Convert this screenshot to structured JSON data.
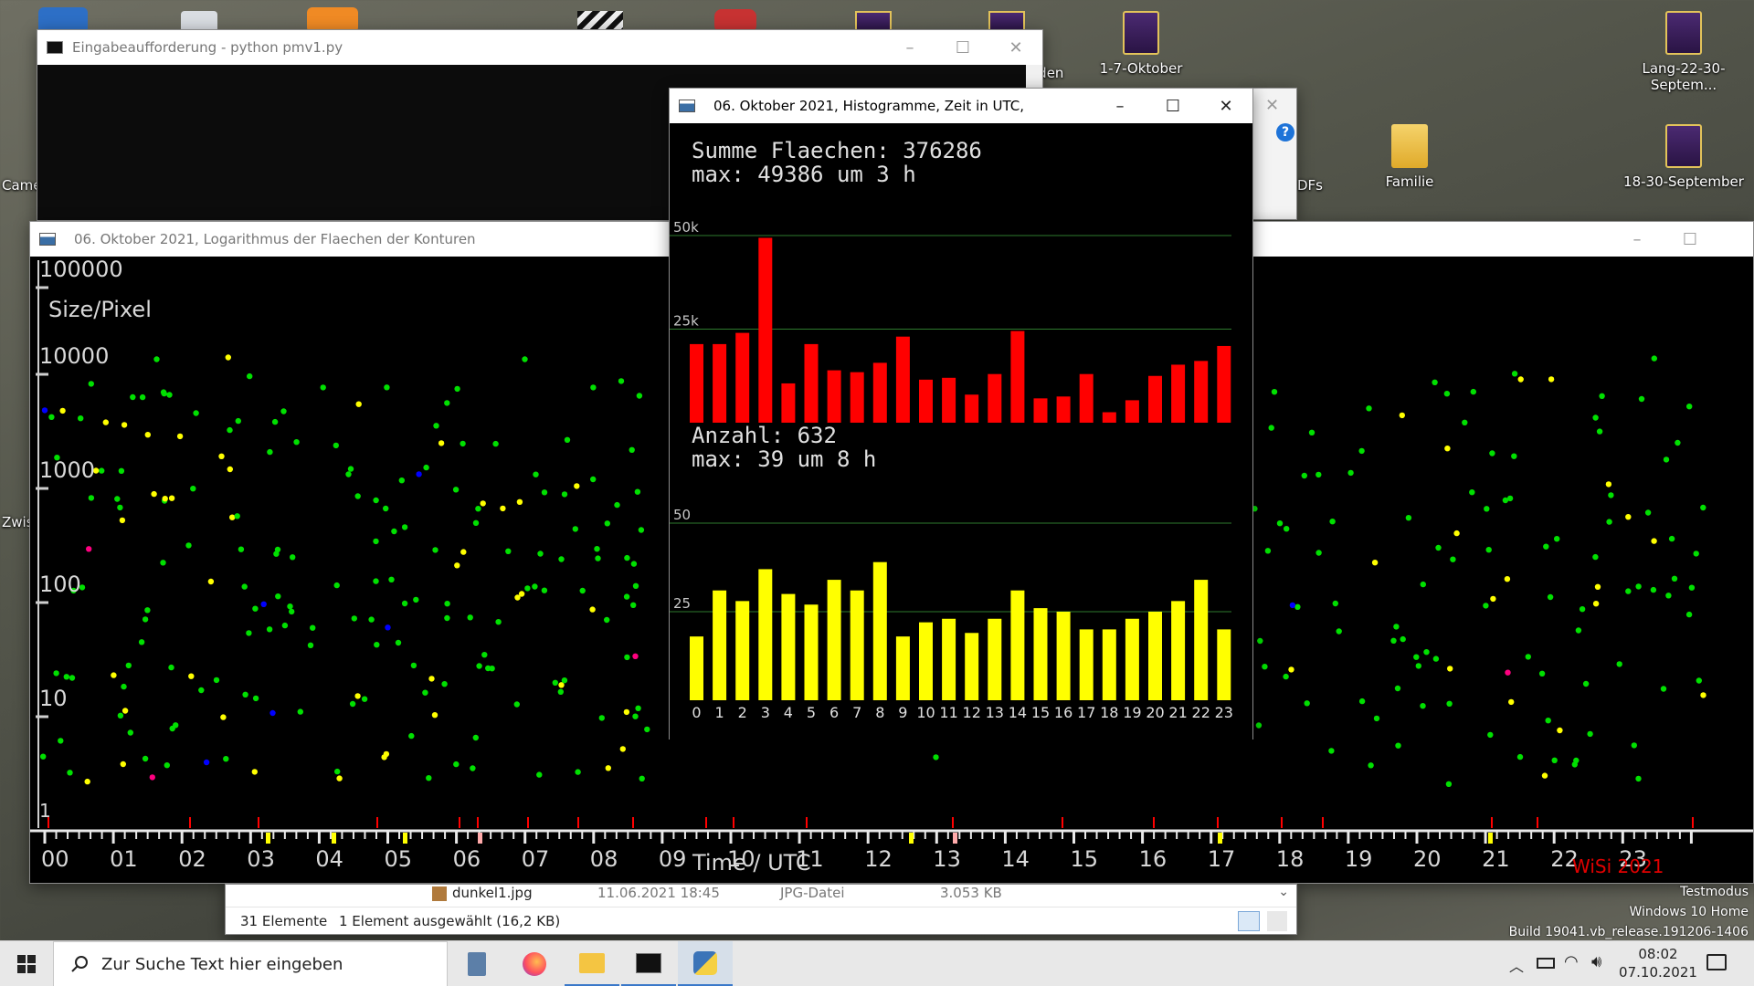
{
  "desktop": {
    "icons": [
      {
        "label": "1-7-Oktober",
        "kind": "folder-dark"
      },
      {
        "label": "Lang-22-30-Septem...",
        "kind": "folder-dark"
      },
      {
        "label": "Familie",
        "kind": "folder"
      },
      {
        "label": "18-30-September",
        "kind": "folder-dark"
      },
      {
        "label": "iden",
        "kind": "partial"
      },
      {
        "label": "DFs",
        "kind": "partial"
      },
      {
        "label": "Came",
        "kind": "partial"
      },
      {
        "label": "Zwis",
        "kind": "partial"
      }
    ]
  },
  "cmd_window": {
    "title": "Eingabeaufforderung - python  pmv1.py"
  },
  "scatter_window": {
    "title": "06. Oktober 2021, Logarithmus der Flaechen der Konturen",
    "ylabel": "Size/Pixel",
    "yticks": [
      "100000",
      "10000",
      "1000",
      "100",
      "10",
      "1"
    ],
    "hours": [
      "00",
      "01",
      "02",
      "03",
      "04",
      "05",
      "06",
      "07",
      "08",
      "09",
      "10",
      "11",
      "12",
      "13",
      "14",
      "15",
      "16",
      "17",
      "18",
      "19",
      "20",
      "21",
      "22",
      "23"
    ],
    "xlabel": "Time  /  UTC",
    "signature": "WiSi 2021"
  },
  "hist_window": {
    "title": "06. Oktober 2021, Histogramme, Zeit in UTC,",
    "area_line1": "Summe Flaechen: 376286",
    "area_line2": "max: 49386 um 3 h",
    "count_line1": "Anzahl: 632",
    "count_line2": "max: 39 um 8 h",
    "area_ticks": [
      "50k",
      "25k"
    ],
    "count_ticks": [
      "50",
      "25"
    ],
    "hours": [
      "0",
      "1",
      "2",
      "3",
      "4",
      "5",
      "6",
      "7",
      "8",
      "9",
      "10",
      "11",
      "12",
      "13",
      "14",
      "15",
      "16",
      "17",
      "18",
      "19",
      "20",
      "21",
      "22",
      "23"
    ]
  },
  "chart_data": [
    {
      "type": "bar",
      "title": "Summe Flaechen: 376286",
      "categories": [
        "0",
        "1",
        "2",
        "3",
        "4",
        "5",
        "6",
        "7",
        "8",
        "9",
        "10",
        "11",
        "12",
        "13",
        "14",
        "15",
        "16",
        "17",
        "18",
        "19",
        "20",
        "21",
        "22",
        "23"
      ],
      "values": [
        21000,
        21000,
        24000,
        49386,
        10500,
        21000,
        14000,
        13500,
        16000,
        23000,
        11500,
        12000,
        7500,
        13000,
        24500,
        6500,
        7000,
        13000,
        2800,
        6000,
        12500,
        15500,
        16500,
        20500
      ],
      "ylim": [
        0,
        50000
      ],
      "yticks": [
        "25k",
        "50k"
      ],
      "color": "#ff0000"
    },
    {
      "type": "bar",
      "title": "Anzahl: 632",
      "categories": [
        "0",
        "1",
        "2",
        "3",
        "4",
        "5",
        "6",
        "7",
        "8",
        "9",
        "10",
        "11",
        "12",
        "13",
        "14",
        "15",
        "16",
        "17",
        "18",
        "19",
        "20",
        "21",
        "22",
        "23"
      ],
      "values": [
        18,
        31,
        28,
        37,
        30,
        27,
        34,
        31,
        39,
        18,
        22,
        23,
        19,
        23,
        31,
        26,
        25,
        20,
        20,
        23,
        25,
        28,
        34,
        20
      ],
      "ylim": [
        0,
        50
      ],
      "yticks": [
        "25",
        "50"
      ],
      "color": "#ffff00"
    }
  ],
  "explorer": {
    "file_name": "dunkel1.jpg",
    "file_date": "11.06.2021 18:45",
    "file_type": "JPG-Datei",
    "file_size": "3.053 KB",
    "count": "31 Elemente",
    "selection": "1 Element ausgewählt (16,2 KB)"
  },
  "watermark": {
    "line1": "Testmodus",
    "line2": "Windows 10 Home",
    "line3": "Build 19041.vb_release.191206-1406"
  },
  "taskbar": {
    "search_placeholder": "Zur Suche Text hier eingeben",
    "time": "08:02",
    "date": "07.10.2021"
  },
  "colors": {
    "scatter_green": "#00e000",
    "scatter_yellow": "#ffff00",
    "scatter_blue": "#0000ff",
    "scatter_magenta": "#ff0080",
    "hist_red": "#ff0000",
    "hist_yellow": "#ffff00",
    "grid_green": "#2e7a2e"
  }
}
